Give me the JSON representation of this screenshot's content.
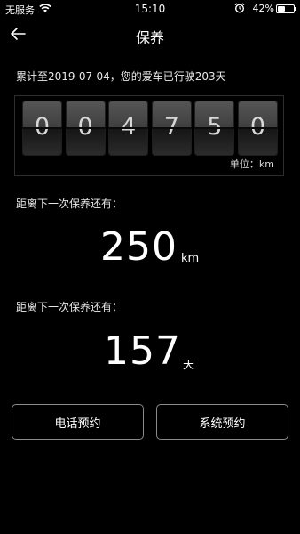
{
  "status_bar": {
    "carrier": "无服务",
    "time": "15:10",
    "battery_percent_label": "42%",
    "battery_level": 0.42,
    "icons": [
      "wifi-icon",
      "alarm-icon",
      "battery-icon"
    ]
  },
  "nav": {
    "title": "保养",
    "back_icon": "back-arrow-icon"
  },
  "summary": {
    "since_text": "累计至2019-07-04，您的爱车已行驶203天"
  },
  "odometer": {
    "digits": [
      "0",
      "0",
      "4",
      "7",
      "5",
      "0"
    ],
    "unit_label": "单位：km"
  },
  "next_distance": {
    "label": "距离下一次保养还有：",
    "value": "250",
    "unit": "km"
  },
  "next_days": {
    "label": "距离下一次保养还有：",
    "value": "157",
    "unit": "天"
  },
  "buttons": {
    "phone_booking": "电话预约",
    "system_booking": "系统预约"
  },
  "colors": {
    "background": "#000000",
    "text": "#ffffff",
    "button_border": "#8a8a8a",
    "panel_border": "#2e2e2e"
  }
}
